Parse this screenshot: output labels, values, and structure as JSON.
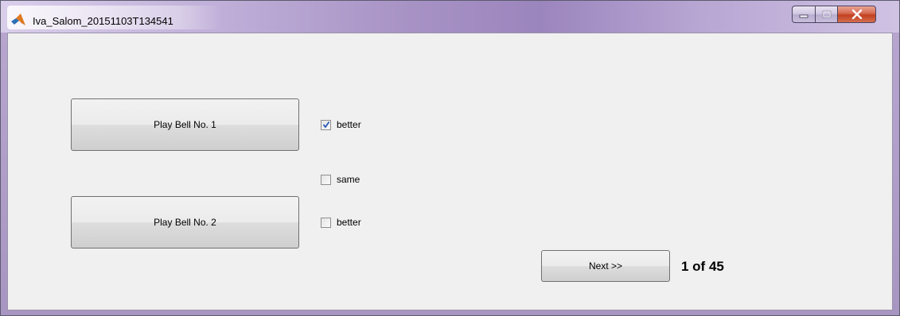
{
  "window": {
    "title": "Iva_Salom_20151103T134541",
    "icon": "matlab-icon"
  },
  "caption_buttons": {
    "minimize_icon": "minimize-icon",
    "maximize_icon": "maximize-icon",
    "close_icon": "close-icon"
  },
  "buttons": {
    "play_bell_1": "Play Bell No. 1",
    "play_bell_2": "Play Bell No. 2",
    "next": "Next >>"
  },
  "checkboxes": [
    {
      "label": "better",
      "checked": true
    },
    {
      "label": "same",
      "checked": false
    },
    {
      "label": "better",
      "checked": false
    }
  ],
  "progress": {
    "text": "1 of 45"
  },
  "colors": {
    "client_background": "#f0f0f0",
    "close_button": "#c2401f",
    "checkmark": "#2a5ab5"
  }
}
